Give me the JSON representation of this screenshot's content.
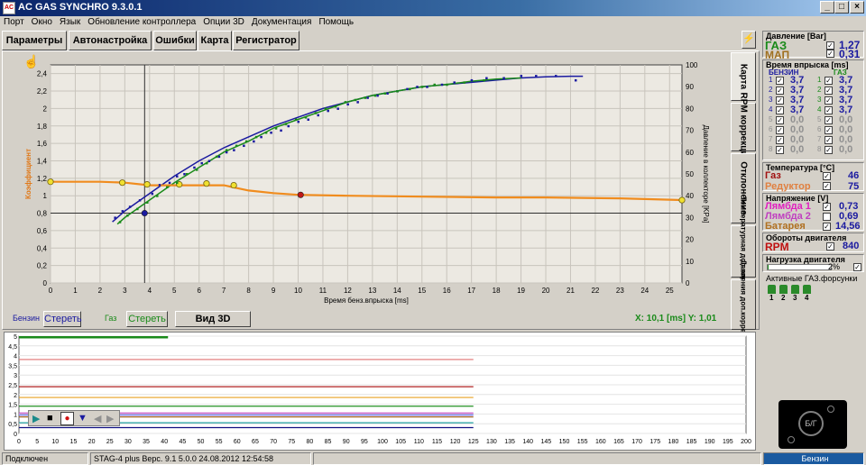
{
  "window": {
    "icon_text": "AC",
    "title": "AC GAS SYNCHRO  9.3.0.1",
    "min_label": "_",
    "max_label": "□",
    "close_label": "×"
  },
  "menu": [
    "Порт",
    "Окно",
    "Язык",
    "Обновление контроллера",
    "Опции 3D",
    "Документация",
    "Помощь"
  ],
  "tabs": [
    "Параметры",
    "Автонастройка",
    "Ошибки",
    "Карта",
    "Регистратор"
  ],
  "vtabs": [
    "Карта",
    "RPM коррекция",
    "Отклонение",
    "Температурная доп.коррекция",
    "Давления доп.коррекция"
  ],
  "controls": {
    "benzin_label": "Бензин",
    "benzin_clear": "Стереть",
    "gaz_label": "Газ",
    "gaz_clear": "Стереть",
    "view3d": "Вид 3D",
    "coord_readout": "X: 10,1 [ms]  Y: 1,01"
  },
  "chart_data": {
    "type": "scatter",
    "xlabel": "Время бенз.впрыска [ms]",
    "ylabel": "Коэффициент",
    "y2label": "Давление в коллекторе [KPa]",
    "x_ticks": [
      0,
      1,
      2,
      3,
      4,
      5,
      6,
      7,
      8,
      9,
      10,
      11,
      12,
      13,
      14,
      15,
      16,
      17,
      18,
      19,
      20,
      21,
      22,
      23,
      24,
      25
    ],
    "y_ticks": [
      "0",
      "0,2",
      "0,4",
      "0,6",
      "0,8",
      "1",
      "1,2",
      "1,4",
      "1,6",
      "1,8",
      "2",
      "2,2",
      "2,4"
    ],
    "y2_ticks": [
      "0",
      "10",
      "20",
      "30",
      "40",
      "50",
      "60",
      "70",
      "80",
      "90",
      "100"
    ],
    "xlim": [
      0,
      25.5
    ],
    "ylim": [
      0,
      2.5
    ],
    "y2lim": [
      0,
      100
    ],
    "cursor": {
      "x": 3.8,
      "y": 0.8
    },
    "grid": true,
    "series": [
      {
        "role": "benzin_fit",
        "color": "#1a1aa0",
        "axis": "y2",
        "points": [
          [
            2.5,
            28
          ],
          [
            3,
            33
          ],
          [
            4,
            41
          ],
          [
            5,
            49
          ],
          [
            6,
            56
          ],
          [
            7,
            62
          ],
          [
            8,
            67
          ],
          [
            9,
            72
          ],
          [
            10,
            76
          ],
          [
            11,
            80
          ],
          [
            12,
            83
          ],
          [
            13,
            86
          ],
          [
            14,
            88
          ],
          [
            15,
            90
          ],
          [
            16,
            91
          ],
          [
            17,
            92
          ],
          [
            18,
            93
          ],
          [
            19,
            94
          ],
          [
            20,
            94.5
          ],
          [
            21,
            94.8
          ],
          [
            21.5,
            94.8
          ]
        ]
      },
      {
        "role": "gaz_fit",
        "color": "#1a8a1a",
        "axis": "y2",
        "points": [
          [
            2.7,
            27
          ],
          [
            3,
            30
          ],
          [
            4,
            38
          ],
          [
            5,
            46
          ],
          [
            6,
            53
          ],
          [
            7,
            60
          ],
          [
            8,
            65
          ],
          [
            9,
            71
          ],
          [
            10,
            75
          ],
          [
            11,
            79
          ],
          [
            12,
            83
          ],
          [
            13,
            86
          ],
          [
            14,
            88
          ],
          [
            15,
            90
          ],
          [
            16,
            91
          ],
          [
            17,
            92.5
          ],
          [
            18,
            93.5
          ],
          [
            19,
            94
          ]
        ]
      },
      {
        "role": "coefficient",
        "color": "#f08c1e",
        "axis": "y",
        "points": [
          [
            0,
            1.16
          ],
          [
            2,
            1.16
          ],
          [
            3,
            1.15
          ],
          [
            4,
            1.12
          ],
          [
            5,
            1.12
          ],
          [
            6,
            1.12
          ],
          [
            7,
            1.12
          ],
          [
            8,
            1.06
          ],
          [
            9,
            1.03
          ],
          [
            10,
            1.01
          ],
          [
            12,
            1.0
          ],
          [
            15,
            0.99
          ],
          [
            18,
            0.98
          ],
          [
            20,
            0.98
          ],
          [
            23,
            0.97
          ],
          [
            25.5,
            0.95
          ]
        ]
      },
      {
        "role": "coef_nodes",
        "color": "#f0e030",
        "axis": "y",
        "points": [
          [
            0,
            1.16
          ],
          [
            2.9,
            1.15
          ],
          [
            3.9,
            1.13
          ],
          [
            5.2,
            1.13
          ],
          [
            6.3,
            1.14
          ],
          [
            7.4,
            1.12
          ],
          [
            25.5,
            0.95
          ]
        ]
      },
      {
        "role": "benzin_points",
        "color": "#1a1aa0",
        "axis": "y2",
        "points": [
          [
            2.6,
            30
          ],
          [
            2.9,
            33
          ],
          [
            3.2,
            35
          ],
          [
            3.6,
            38
          ],
          [
            4.1,
            41
          ],
          [
            4.4,
            45
          ],
          [
            4.8,
            46
          ],
          [
            5.1,
            49
          ],
          [
            5.4,
            50
          ],
          [
            5.8,
            53
          ],
          [
            6.1,
            55
          ],
          [
            6.4,
            56
          ],
          [
            6.8,
            58
          ],
          [
            7.1,
            60
          ],
          [
            7.4,
            61
          ],
          [
            7.8,
            63
          ],
          [
            8.2,
            65
          ],
          [
            8.5,
            67
          ],
          [
            8.9,
            69
          ],
          [
            9.3,
            70
          ],
          [
            9.6,
            72
          ],
          [
            10.0,
            74
          ],
          [
            10.4,
            75
          ],
          [
            10.8,
            77
          ],
          [
            11.2,
            79
          ],
          [
            11.6,
            80
          ],
          [
            12.0,
            82
          ],
          [
            12.4,
            83
          ],
          [
            12.8,
            85
          ],
          [
            13.2,
            86
          ],
          [
            13.6,
            87
          ],
          [
            14.0,
            88
          ],
          [
            14.4,
            89
          ],
          [
            14.8,
            90
          ],
          [
            15.2,
            90
          ],
          [
            15.8,
            91
          ],
          [
            16.3,
            92
          ],
          [
            17.0,
            93
          ],
          [
            17.6,
            94
          ],
          [
            18.3,
            94
          ],
          [
            19.0,
            95
          ],
          [
            19.6,
            95
          ],
          [
            20.4,
            95
          ],
          [
            21.2,
            93
          ]
        ]
      },
      {
        "role": "gaz_points",
        "color": "#1a8a1a",
        "axis": "y2",
        "points": [
          [
            2.8,
            28
          ],
          [
            3.1,
            31
          ],
          [
            3.5,
            34
          ],
          [
            3.9,
            37
          ],
          [
            4.3,
            40
          ],
          [
            4.7,
            44
          ],
          [
            5.1,
            46
          ],
          [
            5.5,
            50
          ],
          [
            5.9,
            52
          ],
          [
            6.3,
            55
          ],
          [
            6.7,
            58
          ],
          [
            7.1,
            61
          ],
          [
            7.5,
            63
          ],
          [
            7.9,
            65
          ],
          [
            8.3,
            67
          ],
          [
            8.7,
            69
          ],
          [
            9.1,
            71
          ],
          [
            9.5,
            73
          ],
          [
            9.9,
            75
          ],
          [
            10.3,
            76
          ],
          [
            10.7,
            78
          ],
          [
            11.1,
            80
          ],
          [
            11.5,
            81
          ],
          [
            11.9,
            83
          ],
          [
            12.3,
            84
          ],
          [
            12.7,
            85
          ],
          [
            13.1,
            86
          ],
          [
            13.5,
            87
          ],
          [
            14.0,
            88
          ],
          [
            14.5,
            89
          ],
          [
            15.0,
            90
          ],
          [
            15.5,
            91
          ],
          [
            16.0,
            91
          ],
          [
            16.7,
            92
          ],
          [
            17.5,
            93
          ]
        ]
      }
    ],
    "markers": [
      {
        "x": 10.1,
        "y": 1.01,
        "color": "#c01818"
      },
      {
        "x": 3.8,
        "y": 0.8,
        "color": "#1a1aa0"
      }
    ]
  },
  "lower_chart": {
    "y_ticks": [
      "0",
      "0,5",
      "1",
      "1,5",
      "2",
      "2,5",
      "3",
      "3,5",
      "4",
      "4,5",
      "5"
    ],
    "x_ticks": [
      0,
      5,
      10,
      15,
      20,
      25,
      30,
      35,
      40,
      45,
      50,
      55,
      60,
      65,
      70,
      75,
      80,
      85,
      90,
      95,
      100,
      105,
      110,
      115,
      120,
      125,
      130,
      135,
      140,
      145,
      150,
      155,
      160,
      165,
      170,
      175,
      180,
      185,
      190,
      195,
      200
    ],
    "ylim": [
      0,
      5
    ],
    "xlim": [
      0,
      200
    ],
    "traces": [
      {
        "color": "#e07070",
        "y": 3.8
      },
      {
        "color": "#b02020",
        "y": 2.4
      },
      {
        "color": "#e8a020",
        "y": 1.85
      },
      {
        "color": "#209020",
        "y": 1.4
      },
      {
        "color": "#c040c0",
        "y": 1.05
      },
      {
        "color": "#6060e0",
        "y": 0.95
      },
      {
        "color": "#a06020",
        "y": 0.85
      },
      {
        "color": "#20a0a0",
        "y": 0.55
      },
      {
        "color": "#101080",
        "y": 0.3
      }
    ]
  },
  "status": {
    "conn": "Подключен",
    "device": "STAG-4 plus   Верс. 9.1  5.0.0    24.08.2012 12:54:58",
    "fuel": "Бензин"
  },
  "right": {
    "pressure_title": "Давление [Bar]",
    "gaz_label": "ГАЗ",
    "gaz_value": "1,27",
    "map_label": "МАП",
    "map_value": "0,31",
    "inj_title": "Время впрыска [ms]",
    "benzin_col": "БЕНЗИН",
    "gaz_col": "ГАЗ",
    "inj_rows": [
      {
        "n1": "1",
        "b": "3,7",
        "n2": "1",
        "g": "3,7"
      },
      {
        "n1": "2",
        "b": "3,7",
        "n2": "2",
        "g": "3,7"
      },
      {
        "n1": "3",
        "b": "3,7",
        "n2": "3",
        "g": "3,7"
      },
      {
        "n1": "4",
        "b": "3,7",
        "n2": "4",
        "g": "3,7"
      },
      {
        "n1": "5",
        "b": "0,0",
        "n2": "5",
        "g": "0,0"
      },
      {
        "n1": "6",
        "b": "0,0",
        "n2": "6",
        "g": "0,0"
      },
      {
        "n1": "7",
        "b": "0,0",
        "n2": "7",
        "g": "0,0"
      },
      {
        "n1": "8",
        "b": "0,0",
        "n2": "8",
        "g": "0,0"
      }
    ],
    "temp_title": "Температура [°C]",
    "temp_gaz_label": "Газ",
    "temp_gaz": "46",
    "temp_red_label": "Редуктор",
    "temp_red": "75",
    "volt_title": "Напряжение [V]",
    "l1_label": "Лямбда 1",
    "l1": "0,73",
    "l2_label": "Лямбда 2",
    "l2": "0,69",
    "bat_label": "Батарея",
    "bat": "14,56",
    "rpm_title": "Обороты двигателя",
    "rpm_label": "RPM",
    "rpm": "840",
    "load_title": "Нагрузка двигателя",
    "load": "2%",
    "injectors_title": "Активные ГАЗ.форсунки",
    "injectors": [
      "1",
      "2",
      "3",
      "4"
    ],
    "switch_label": "Б/Г"
  }
}
